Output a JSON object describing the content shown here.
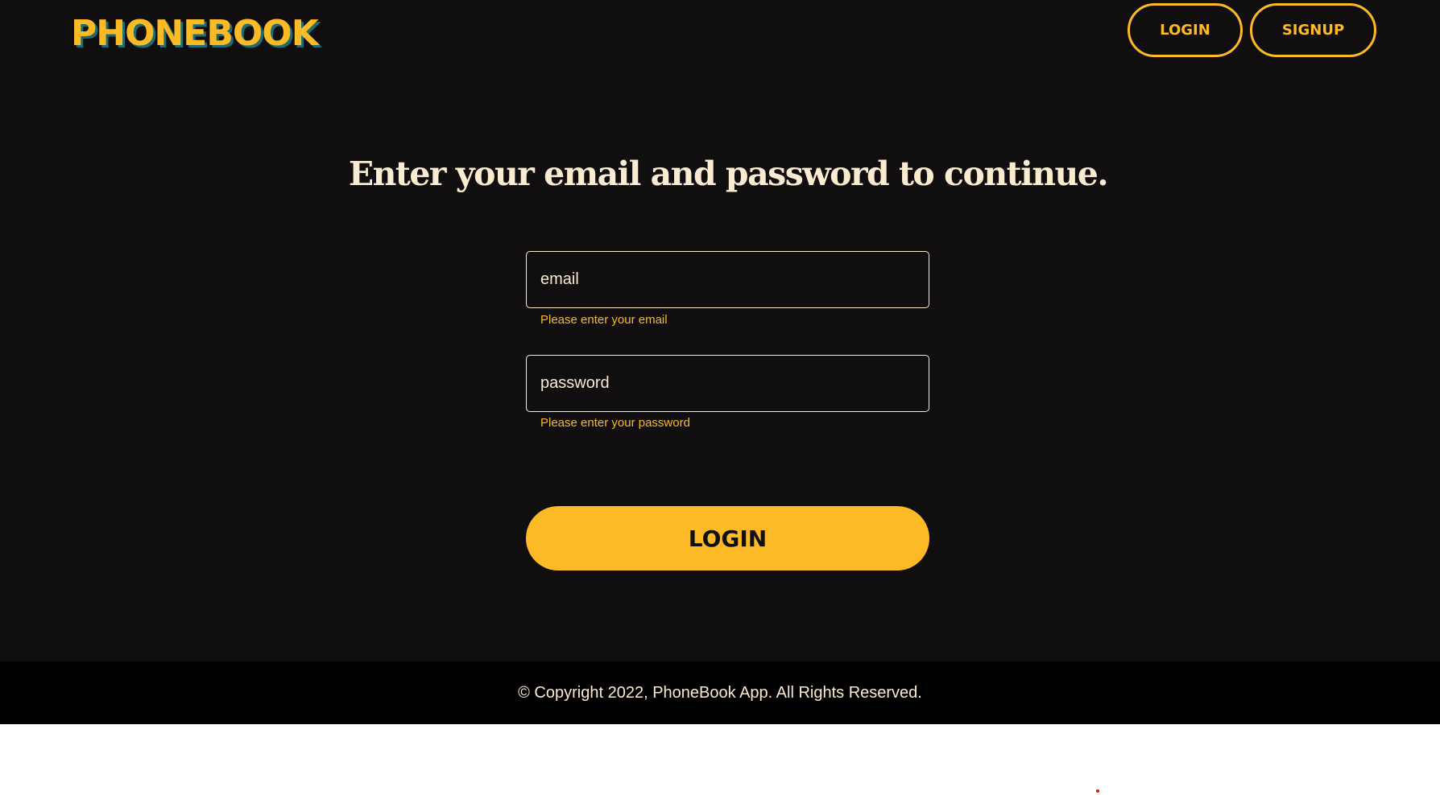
{
  "header": {
    "logo": "PHONEBOOK",
    "nav": {
      "login_label": "LOGIN",
      "signup_label": "SIGNUP"
    }
  },
  "form": {
    "heading": "Enter your email and password to continue.",
    "email": {
      "placeholder": "email",
      "value": "",
      "helper": "Please enter your email"
    },
    "password": {
      "placeholder": "password",
      "value": "",
      "helper": "Please enter your password"
    },
    "submit_label": "LOGIN"
  },
  "footer": {
    "text": "© Copyright 2022, PhoneBook App. All Rights Reserved."
  },
  "colors": {
    "background": "#100e0f",
    "accent": "#fbba26",
    "text_light": "#fbebd0",
    "footer_bg": "#000000",
    "logo_shadow": "#1d6b75"
  }
}
